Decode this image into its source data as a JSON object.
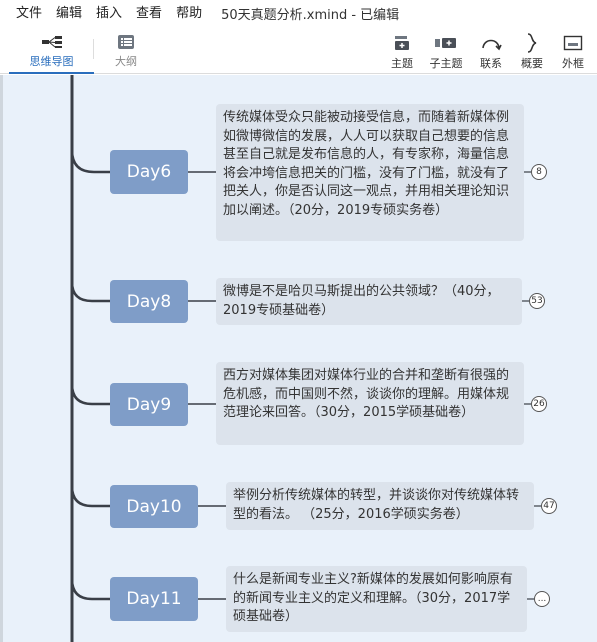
{
  "menu": {
    "items": [
      "文件",
      "编辑",
      "插入",
      "查看",
      "帮助"
    ],
    "window_title": "50天真题分析.xmind - 已编辑"
  },
  "toolbar": {
    "view_tabs": [
      "思维导图",
      "大纲"
    ],
    "tools": {
      "topic": "主题",
      "subtopic": "子主题",
      "relationship": "联系",
      "summary": "概要",
      "boundary": "外框"
    }
  },
  "colors": {
    "node": "#7f9dc8",
    "note": "#dce3ec",
    "canvas": "#e9f1fa",
    "trunk": "#3a3f47",
    "accent": "#2a6ebd"
  },
  "topics": [
    {
      "label": "Day6",
      "text": "传统媒体受众只能被动接受信息，而随着新媒体例如微博微信的发展，人人可以获取自己想要的信息甚至自己就是发布信息的人，有专家称，海量信息将会冲垮信息把关的门槛，没有了门槛，就没有了把关人，你是否认同这一观点，并用相关理论知识加以阐述。（20分，2019专硕实务卷）",
      "badge": "8"
    },
    {
      "label": "Day8",
      "text": "微博是不是哈贝马斯提出的公共领域？（40分，2019专硕基础卷）",
      "badge": "53"
    },
    {
      "label": "Day9",
      "text": "西方对媒体集团对媒体行业的合并和垄断有很强的危机感，而中国则不然，谈谈你的理解。用媒体规范理论来回答。（30分，2015学硕基础卷）",
      "badge": "26"
    },
    {
      "label": "Day10",
      "text": "举例分析传统媒体的转型，并谈谈你对传统媒体转型的看法。 （25分，2016学硕实务卷）",
      "badge": "47"
    },
    {
      "label": "Day11",
      "text": "什么是新闻专业主义?新媒体的发展如何影响原有的新闻专业主义的定义和理解。（30分，2017学硕基础卷）",
      "badge": "..."
    }
  ]
}
